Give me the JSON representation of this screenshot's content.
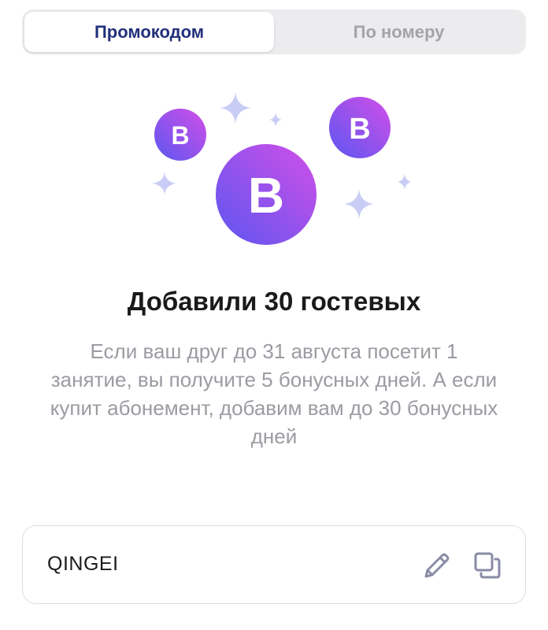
{
  "tabs": {
    "promo_label": "Промокодом",
    "phone_label": "По номеру"
  },
  "content": {
    "title": "Добавили 30 гостевых",
    "description": "Если ваш друг до 31 августа посетит 1 занятие, вы получите 5 бонусных дней. А если купит абонемент, добавим вам до 30 бонусных дней"
  },
  "illustration": {
    "coin_letter": "B"
  },
  "promo": {
    "code": "QINGEI"
  },
  "colors": {
    "accent_dark": "#23307a",
    "coin_gradient_start": "#5b57f0",
    "coin_gradient_end": "#d34ee8",
    "sparkle": "#c9cdf5",
    "muted_text": "#9b9ba2",
    "icon": "#8a8ba6"
  }
}
